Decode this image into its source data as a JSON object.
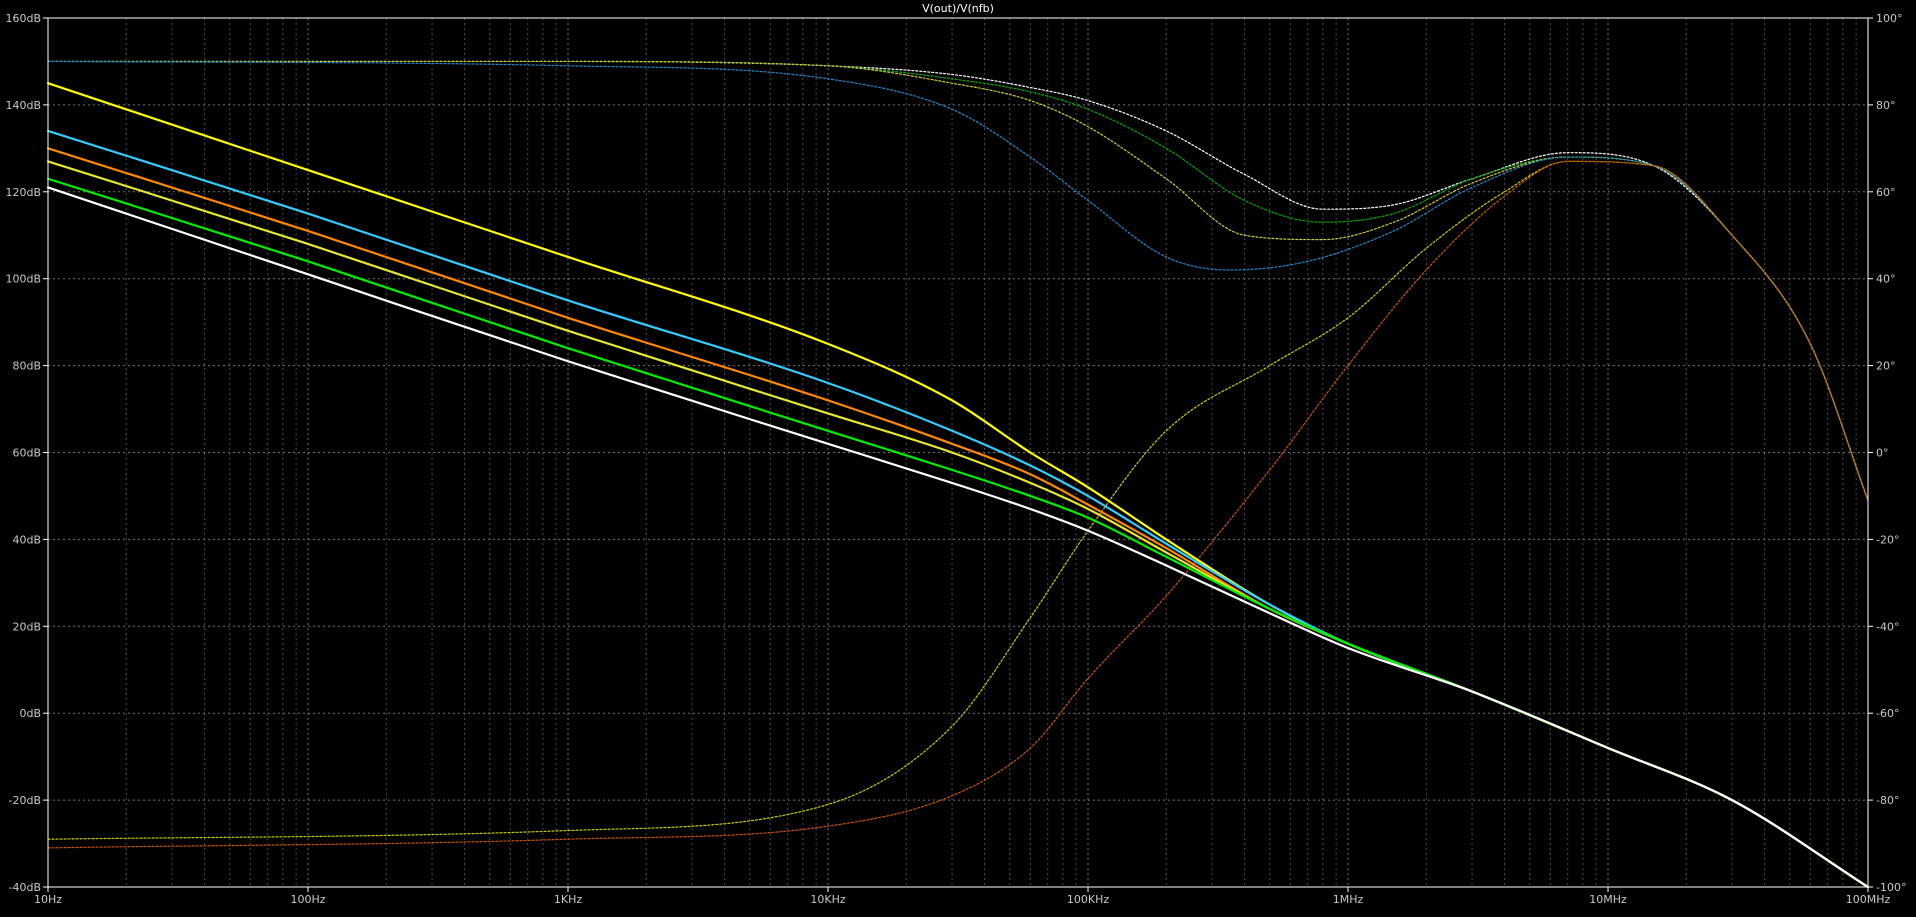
{
  "chart_data": {
    "type": "line",
    "title": "V(out)/V(nfb)",
    "x_scale": "log",
    "xlim": [
      10,
      100000000
    ],
    "x_tick_labels": [
      "10Hz",
      "100Hz",
      "1KHz",
      "10KHz",
      "100KHz",
      "1MHz",
      "10MHz",
      "100MHz"
    ],
    "x_tick_values": [
      10,
      100,
      1000,
      10000,
      100000,
      1000000,
      10000000,
      100000000
    ],
    "y_left_range": [
      -40,
      160
    ],
    "y_left_tick_labels": [
      "160dB",
      "140dB",
      "120dB",
      "100dB",
      "80dB",
      "60dB",
      "40dB",
      "20dB",
      "0dB",
      "-20dB",
      "-40dB"
    ],
    "y_left_tick_values": [
      160,
      140,
      120,
      100,
      80,
      60,
      40,
      20,
      0,
      -20,
      -40
    ],
    "y_right_range": [
      -100,
      100
    ],
    "y_right_tick_labels": [
      "100°",
      "80°",
      "60°",
      "40°",
      "20°",
      "0°",
      "-20°",
      "-40°",
      "-60°",
      "-80°",
      "-100°"
    ],
    "y_right_tick_values": [
      100,
      80,
      60,
      40,
      20,
      0,
      -20,
      -40,
      -60,
      -80,
      -100
    ],
    "grid": true,
    "background": "#000000",
    "grid_color": "#808080",
    "axis_color": "#ffffff",
    "series": [
      {
        "color": "#ffff00",
        "style": "solid",
        "axis": "left",
        "x": [
          10,
          100,
          1000,
          10000,
          30000,
          60000,
          100000,
          200000,
          500000,
          1000000,
          3000000,
          10000000,
          30000000,
          100000000
        ],
        "y": [
          145,
          125,
          105,
          85,
          72,
          60,
          52,
          40,
          25,
          16,
          5,
          -8,
          -20,
          -40
        ]
      },
      {
        "color": "#33ccff",
        "style": "solid",
        "axis": "left",
        "x": [
          10,
          100,
          1000,
          10000,
          30000,
          60000,
          100000,
          200000,
          500000,
          1000000,
          3000000,
          10000000,
          30000000,
          100000000
        ],
        "y": [
          134,
          115,
          95,
          76,
          65,
          57,
          50,
          39,
          25,
          16,
          5,
          -8,
          -20,
          -40
        ]
      },
      {
        "color": "#ff8800",
        "style": "solid",
        "axis": "left",
        "x": [
          10,
          100,
          1000,
          10000,
          30000,
          60000,
          100000,
          200000,
          500000,
          1000000,
          3000000,
          10000000,
          30000000,
          100000000
        ],
        "y": [
          130,
          111,
          91,
          72,
          62,
          55,
          48,
          38,
          24,
          16,
          5,
          -8,
          -20,
          -40
        ]
      },
      {
        "color": "#e6e62e",
        "style": "solid",
        "axis": "left",
        "x": [
          10,
          100,
          1000,
          10000,
          30000,
          60000,
          100000,
          200000,
          500000,
          1000000,
          3000000,
          10000000,
          30000000,
          100000000
        ],
        "y": [
          127,
          108,
          88,
          69,
          60,
          53,
          47,
          37,
          24,
          16,
          5,
          -8,
          -20,
          -40
        ]
      },
      {
        "color": "#00ee00",
        "style": "solid",
        "axis": "left",
        "x": [
          10,
          100,
          1000,
          10000,
          30000,
          60000,
          100000,
          200000,
          500000,
          1000000,
          3000000,
          10000000,
          30000000,
          100000000
        ],
        "y": [
          123,
          104,
          84,
          65,
          56,
          50,
          45,
          36,
          24,
          16,
          5,
          -8,
          -20,
          -40
        ]
      },
      {
        "color": "#ffffff",
        "style": "solid",
        "axis": "left",
        "x": [
          10,
          100,
          1000,
          10000,
          30000,
          60000,
          100000,
          200000,
          500000,
          1000000,
          3000000,
          10000000,
          30000000,
          100000000
        ],
        "y": [
          121,
          101,
          81,
          62,
          53,
          47,
          42,
          34,
          23,
          15,
          5,
          -8,
          -20,
          -40
        ]
      },
      {
        "color": "#ffffff",
        "style": "dotted",
        "axis": "right",
        "x": [
          10,
          1000,
          10000,
          30000,
          60000,
          100000,
          200000,
          400000,
          800000,
          1500000,
          3000000,
          7000000,
          15000000,
          30000000,
          60000000,
          100000000
        ],
        "y": [
          90,
          90,
          89,
          87,
          84,
          81,
          74,
          64,
          56,
          57,
          63,
          69,
          66,
          50,
          25,
          -11
        ]
      },
      {
        "color": "#00aa00",
        "style": "dotted",
        "axis": "right",
        "x": [
          10,
          1000,
          10000,
          30000,
          60000,
          100000,
          200000,
          400000,
          800000,
          1500000,
          3000000,
          7000000,
          15000000,
          30000000,
          60000000,
          100000000
        ],
        "y": [
          90,
          90,
          89,
          86,
          83,
          79,
          70,
          58,
          53,
          55,
          63,
          68,
          66,
          50,
          25,
          -11
        ]
      },
      {
        "color": "#cccc33",
        "style": "dotted",
        "axis": "right",
        "x": [
          10,
          1000,
          10000,
          30000,
          60000,
          100000,
          200000,
          400000,
          800000,
          1500000,
          3000000,
          7000000,
          15000000,
          30000000,
          60000000,
          100000000
        ],
        "y": [
          90,
          90,
          89,
          85,
          81,
          75,
          63,
          50,
          49,
          53,
          62,
          68,
          66,
          50,
          25,
          -11
        ]
      },
      {
        "color": "#2288cc",
        "style": "dotted",
        "axis": "right",
        "x": [
          10,
          1000,
          10000,
          30000,
          60000,
          100000,
          200000,
          350000,
          700000,
          1500000,
          3000000,
          7000000,
          15000000,
          30000000,
          60000000,
          100000000
        ],
        "y": [
          90,
          89,
          86,
          79,
          68,
          58,
          45,
          42,
          44,
          51,
          61,
          68,
          66,
          50,
          25,
          -11
        ]
      },
      {
        "color": "#cccc00",
        "style": "dotted",
        "axis": "right",
        "x": [
          10,
          1000,
          10000,
          30000,
          60000,
          100000,
          200000,
          500000,
          1000000,
          2000000,
          4000000,
          7000000,
          15000000,
          30000000,
          60000000,
          100000000
        ],
        "y": [
          -89,
          -87,
          -81,
          -63,
          -38,
          -18,
          5,
          20,
          31,
          47,
          60,
          67,
          66,
          50,
          25,
          -11
        ]
      },
      {
        "color": "#cc5500",
        "style": "dotted",
        "axis": "right",
        "x": [
          10,
          1000,
          10000,
          30000,
          60000,
          100000,
          200000,
          500000,
          1000000,
          2000000,
          4000000,
          7000000,
          15000000,
          30000000,
          60000000,
          100000000
        ],
        "y": [
          -91,
          -89,
          -86,
          -79,
          -68,
          -52,
          -33,
          -4,
          20,
          42,
          59,
          67,
          66,
          50,
          25,
          -11
        ]
      }
    ]
  }
}
